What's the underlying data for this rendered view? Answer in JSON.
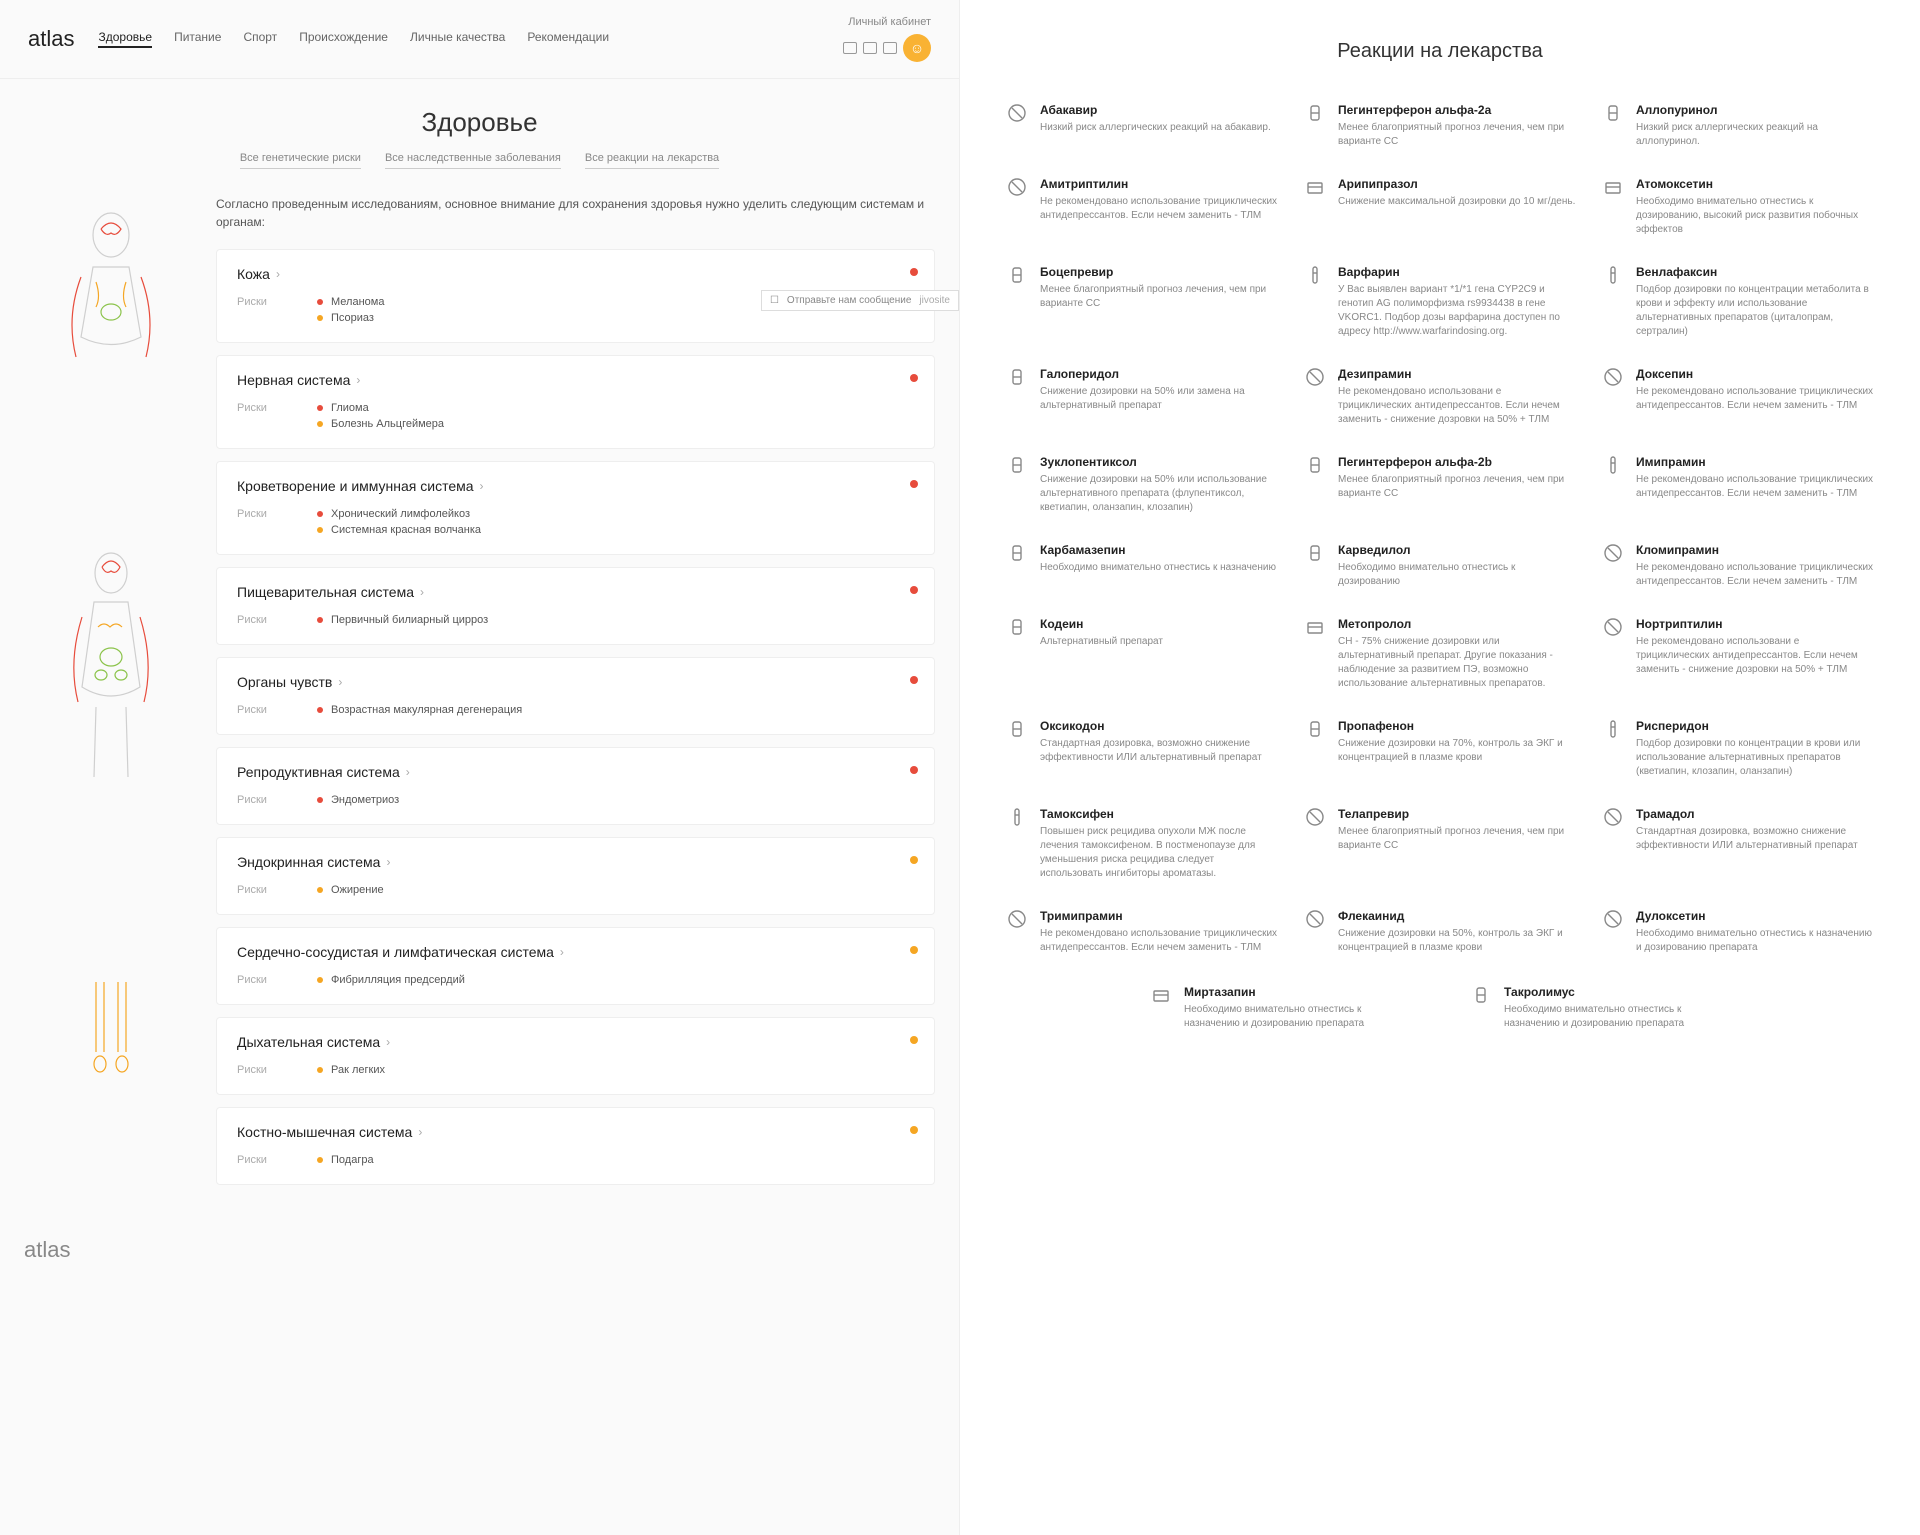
{
  "logo": "atlas",
  "nav": [
    "Здоровье",
    "Питание",
    "Спорт",
    "Происхождение",
    "Личные качества",
    "Рекомендации"
  ],
  "account_label": "Личный кабинет",
  "page_title": "Здоровье",
  "sub_nav": [
    "Все генетические риски",
    "Все наследственные заболевания",
    "Все реакции на лекарства"
  ],
  "intro": "Согласно проведенным исследованиям, основное внимание для сохранения здоровья нужно уделить следующим системам и органам:",
  "risks_label": "Риски",
  "chat_text": "Отправьте нам сообщение",
  "chat_brand": "jivosite",
  "cards": [
    {
      "title": "Кожа",
      "dot": "red",
      "items": [
        {
          "c": "r",
          "t": "Меланома"
        },
        {
          "c": "o",
          "t": "Псориаз"
        }
      ]
    },
    {
      "title": "Нервная система",
      "dot": "red",
      "items": [
        {
          "c": "r",
          "t": "Глиома"
        },
        {
          "c": "o",
          "t": "Болезнь Альцгеймера"
        }
      ]
    },
    {
      "title": "Кроветворение и иммунная система",
      "dot": "red",
      "items": [
        {
          "c": "r",
          "t": "Хронический лимфолейкоз"
        },
        {
          "c": "o",
          "t": "Системная красная волчанка"
        }
      ]
    },
    {
      "title": "Пищеварительная система",
      "dot": "red",
      "items": [
        {
          "c": "r",
          "t": "Первичный билиарный цирроз"
        }
      ]
    },
    {
      "title": "Органы чувств",
      "dot": "red",
      "items": [
        {
          "c": "r",
          "t": "Возрастная макулярная дегенерация"
        }
      ]
    },
    {
      "title": "Репродуктивная система",
      "dot": "red",
      "items": [
        {
          "c": "r",
          "t": "Эндометриоз"
        }
      ]
    },
    {
      "title": "Эндокринная система",
      "dot": "or",
      "items": [
        {
          "c": "o",
          "t": "Ожирение"
        }
      ]
    },
    {
      "title": "Сердечно-сосудистая и лимфатическая система",
      "dot": "or",
      "items": [
        {
          "c": "o",
          "t": "Фибрилляция предсердий"
        }
      ]
    },
    {
      "title": "Дыхательная система",
      "dot": "or",
      "items": [
        {
          "c": "o",
          "t": "Рак легких"
        }
      ]
    },
    {
      "title": "Костно-мышечная система",
      "dot": "or",
      "items": [
        {
          "c": "o",
          "t": "Подагра"
        }
      ]
    }
  ],
  "right_title": "Реакции на лекарства",
  "meds": [
    {
      "ic": "ban",
      "n": "Абакавир",
      "d": "Низкий риск аллергических реакций на абакавир."
    },
    {
      "ic": "pill",
      "n": "Пегинтерферон альфа-2а",
      "d": "Менее благоприятный прогноз лечения, чем при варианте CC"
    },
    {
      "ic": "pill",
      "n": "Аллопуринол",
      "d": "Низкий риск аллергических реакций на аллопуринол."
    },
    {
      "ic": "ban",
      "n": "Амитриптилин",
      "d": "Не рекомендовано использование трициклических антидепрессантов. Если нечем заменить - ТЛМ"
    },
    {
      "ic": "card",
      "n": "Арипипразол",
      "d": "Снижение максимальной дозировки до 10 мг/день."
    },
    {
      "ic": "card",
      "n": "Атомоксетин",
      "d": "Необходимо внимательно отнестись к дозированию, высокий риск развития побочных эффектов"
    },
    {
      "ic": "pill",
      "n": "Боцепревир",
      "d": "Менее благоприятный прогноз лечения, чем при варианте CC"
    },
    {
      "ic": "tube",
      "n": "Варфарин",
      "d": "У Вас выявлен вариант *1/*1 гена CYP2C9 и генотип AG полиморфизма rs9934438 в гене VKORC1. Подбор дозы варфарина доступен по адресу http://www.warfarindosing.org."
    },
    {
      "ic": "tube",
      "n": "Венлафаксин",
      "d": "Подбор дозировки по концентрации метаболита в крови и эффекту или использование альтернативных препаратов (циталопрам, сертралин)"
    },
    {
      "ic": "pill",
      "n": "Галоперидол",
      "d": "Снижение дозировки на 50% или замена на альтернативный препарат"
    },
    {
      "ic": "ban",
      "n": "Дезипрамин",
      "d": "Не рекомендовано использовани е трициклических антидепрессантов. Если нечем заменить - снижение дозровки на 50% + ТЛМ"
    },
    {
      "ic": "ban",
      "n": "Доксепин",
      "d": "Не рекомендовано использование трициклических антидепрессантов. Если нечем заменить - ТЛМ"
    },
    {
      "ic": "pill",
      "n": "Зуклопентиксол",
      "d": "Снижение дозировки на 50% или использование альтернативного препарата (флупентиксол, кветиапин, оланзапин, клозапин)"
    },
    {
      "ic": "pill",
      "n": "Пегинтерферон альфа-2b",
      "d": "Менее благоприятный прогноз лечения, чем при варианте CC"
    },
    {
      "ic": "tube",
      "n": "Имипрамин",
      "d": "Не рекомендовано использование трициклических антидепрессантов. Если нечем заменить - ТЛМ"
    },
    {
      "ic": "pill",
      "n": "Карбамазепин",
      "d": "Необходимо внимательно отнестись к назначению"
    },
    {
      "ic": "pill",
      "n": "Карведилол",
      "d": "Необходимо внимательно отнестись к дозированию"
    },
    {
      "ic": "ban",
      "n": "Кломипрамин",
      "d": "Не рекомендовано использование трициклических антидепрессантов. Если нечем заменить - ТЛМ"
    },
    {
      "ic": "pill",
      "n": "Кодеин",
      "d": "Альтернативный препарат"
    },
    {
      "ic": "card",
      "n": "Метопролол",
      "d": "СН - 75% снижение дозировки или альтернативный препарат. Другие показания - наблюдение за развитием ПЭ, возможно использование альтернативных препаратов."
    },
    {
      "ic": "ban",
      "n": "Нортриптилин",
      "d": "Не рекомендовано использовани е трициклических антидепрессантов. Если нечем заменить - снижение дозровки на 50% + ТЛМ"
    },
    {
      "ic": "pill",
      "n": "Оксикодон",
      "d": "Стандартная дозировка, возможно снижение эффективности ИЛИ альтернативный препарат"
    },
    {
      "ic": "pill",
      "n": "Пропафенон",
      "d": "Снижение дозировки на 70%, контроль за ЭКГ и концентрацией в плазме крови"
    },
    {
      "ic": "tube",
      "n": "Рисперидон",
      "d": "Подбор дозировки по концентрации в крови или использование альтернативных препаратов (кветиапин, клозапин, оланзапин)"
    },
    {
      "ic": "tube",
      "n": "Тамоксифен",
      "d": "Повышен риск рецидива опухоли МЖ после лечения тамоксифеном. В постменопаузе для уменьшения риска рецидива следует использовать ингибиторы ароматазы."
    },
    {
      "ic": "ban",
      "n": "Телапревир",
      "d": "Менее благоприятный прогноз лечения, чем при варианте CC"
    },
    {
      "ic": "ban",
      "n": "Трамадол",
      "d": "Стандартная дозировка, возможно снижение эффективности ИЛИ альтернативный препарат"
    },
    {
      "ic": "ban",
      "n": "Тримипрамин",
      "d": "Не рекомендовано использование трициклических антидепрессантов. Если нечем заменить - ТЛМ"
    },
    {
      "ic": "ban",
      "n": "Флекаинид",
      "d": "Снижение дозировки на 50%, контроль за ЭКГ и концентрацией в плазме крови"
    },
    {
      "ic": "ban",
      "n": "Дулоксетин",
      "d": "Необходимо внимательно отнестись к назначению и дозированию препарата"
    }
  ],
  "meds_bottom": [
    {
      "ic": "card",
      "n": "Миртазапин",
      "d": "Необходимо внимательно отнестись к назначению и дозированию препарата"
    },
    {
      "ic": "pill",
      "n": "Такролимус",
      "d": "Необходимо внимательно отнестись к назначению и дозированию препарата"
    }
  ]
}
